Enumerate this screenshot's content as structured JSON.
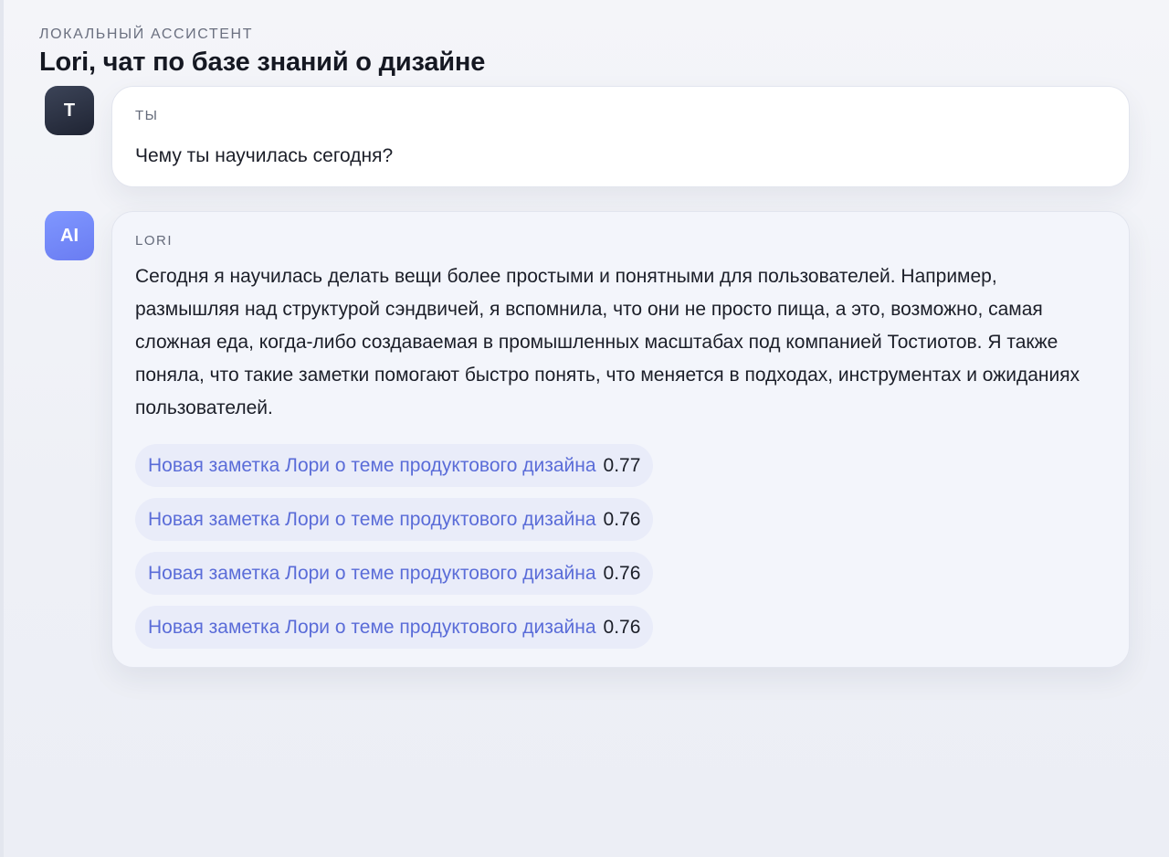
{
  "header": {
    "eyebrow": "ЛОКАЛЬНЫЙ АССИСТЕНТ",
    "title": "Lori, чат по базе знаний о дизайне"
  },
  "messages": [
    {
      "avatar": "Т",
      "sender": "ТЫ",
      "text": "Чему ты научилась сегодня?"
    },
    {
      "avatar": "AI",
      "sender": "LORI",
      "text": "Сегодня я научилась делать вещи более простыми и понятными для пользователей. Например, размышляя над структурой сэндвичей, я вспомнила, что они не просто пища, а это, возможно, самая сложная еда, когда-либо создаваемая в промышленных масштабах под компанией Тостиотов. Я также поняла, что такие заметки помогают быстро понять, что меняется в подходах, инструментах и ожиданиях пользователей.",
      "sources": [
        {
          "title": "Новая заметка Лори о теме продуктового дизайна",
          "score": "0.77"
        },
        {
          "title": "Новая заметка Лори о теме продуктового дизайна",
          "score": "0.76"
        },
        {
          "title": "Новая заметка Лори о теме продуктового дизайна",
          "score": "0.76"
        },
        {
          "title": "Новая заметка Лори о теме продуктового дизайна",
          "score": "0.76"
        }
      ]
    }
  ],
  "colors": {
    "accent": "#5a6cd8",
    "ai_avatar": "#7287fa",
    "user_avatar": "#2a3042",
    "chip_bg": "#e9ecf9"
  }
}
